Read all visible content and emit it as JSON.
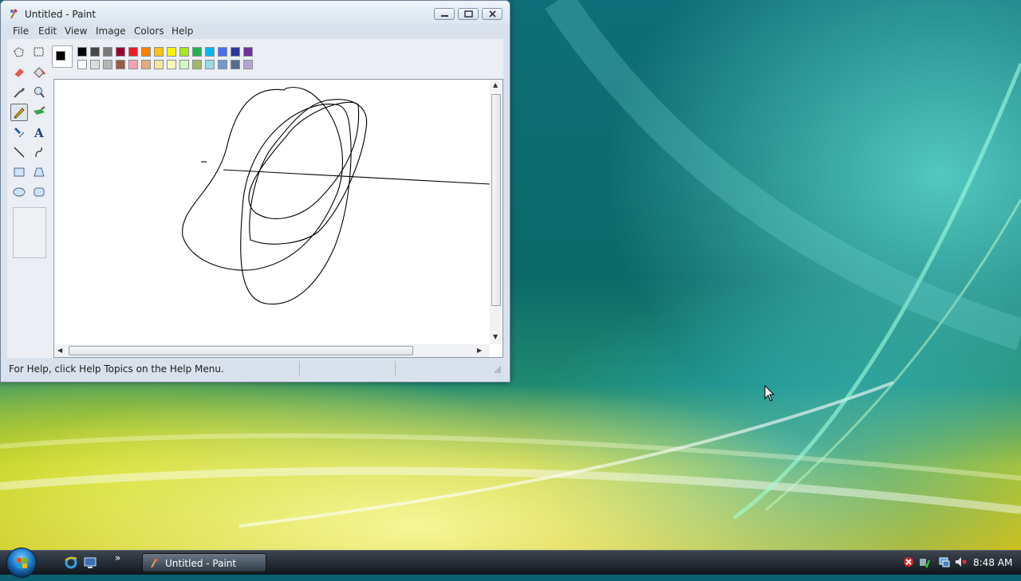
{
  "window": {
    "title": "Untitled - Paint",
    "menus": [
      "File",
      "Edit",
      "View",
      "Image",
      "Colors",
      "Help"
    ],
    "status_text": "For Help, click Help Topics on the Help Menu."
  },
  "tools": [
    {
      "name": "free-form-select-icon",
      "active": false
    },
    {
      "name": "select-icon",
      "active": false
    },
    {
      "name": "eraser-icon",
      "active": false
    },
    {
      "name": "fill-icon",
      "active": false
    },
    {
      "name": "pick-color-icon",
      "active": false
    },
    {
      "name": "magnifier-icon",
      "active": false
    },
    {
      "name": "pencil-icon",
      "active": true
    },
    {
      "name": "brush-icon",
      "active": false
    },
    {
      "name": "airbrush-icon",
      "active": false
    },
    {
      "name": "text-icon",
      "active": false
    },
    {
      "name": "line-icon",
      "active": false
    },
    {
      "name": "curve-icon",
      "active": false
    },
    {
      "name": "rectangle-icon",
      "active": false
    },
    {
      "name": "polygon-icon",
      "active": false
    },
    {
      "name": "ellipse-icon",
      "active": false
    },
    {
      "name": "rounded-rectangle-icon",
      "active": false
    }
  ],
  "palette": {
    "foreground": "#000000",
    "background": "#ffffff",
    "row1": [
      "#000000",
      "#464646",
      "#787878",
      "#990030",
      "#ed1c24",
      "#ff7e00",
      "#ffc20e",
      "#fff200",
      "#a8e61d",
      "#22b14c",
      "#00b7ef",
      "#4d6df3",
      "#2f3699",
      "#6f3198"
    ],
    "row2": [
      "#ffffff",
      "#dcdcdc",
      "#b4b4b4",
      "#9c5a3c",
      "#ffa3b1",
      "#e5aa7a",
      "#f5e49c",
      "#fff9bd",
      "#d3f9bc",
      "#9dbb61",
      "#99d9ea",
      "#709ad1",
      "#546d8e",
      "#b5a5d5"
    ]
  },
  "taskbar": {
    "task_label": "Untitled - Paint",
    "clock": "8:48 AM",
    "more_glyph": "»"
  }
}
